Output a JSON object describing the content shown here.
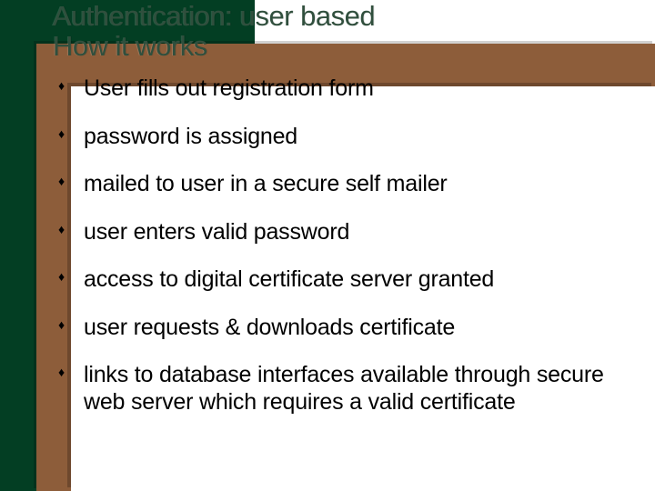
{
  "title_line1": "Authentication: user based",
  "title_line2": "How it works",
  "bullets": [
    "User fills out registration form",
    "password is assigned",
    "mailed to user in a secure self mailer",
    "user enters valid password",
    "access to digital certificate server granted",
    " user requests & downloads certificate",
    " links to database interfaces available through secure web server which requires a valid certificate"
  ]
}
